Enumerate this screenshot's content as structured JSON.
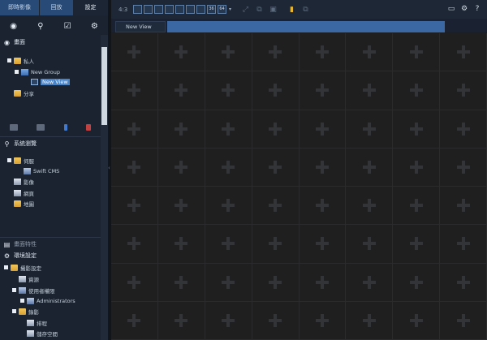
{
  "nav": {
    "tabs": [
      "即時影像",
      "回放",
      "設定"
    ]
  },
  "view_panel": {
    "title": "畫面",
    "tree": [
      {
        "label": "私人"
      },
      {
        "label": "New Group"
      },
      {
        "label": "New View",
        "selected": true
      },
      {
        "label": "分享"
      }
    ]
  },
  "system_panel": {
    "title": "系統瀏覽",
    "tree": [
      {
        "label": "伺服"
      },
      {
        "label": "Swift CMS"
      },
      {
        "label": "影像"
      },
      {
        "label": "網頁"
      },
      {
        "label": "地圖"
      }
    ]
  },
  "properties_panel": {
    "title": "畫面特性"
  },
  "env_panel": {
    "title": "環境設定",
    "tree": [
      {
        "label": "攝影設定"
      },
      {
        "label": "資源"
      },
      {
        "label": "使用者權限"
      },
      {
        "label": "Administrators"
      },
      {
        "label": "錄影"
      },
      {
        "label": "排程"
      },
      {
        "label": "儲存空間"
      }
    ]
  },
  "toolbar": {
    "aspect": "4:3",
    "layout_64": "64",
    "layout_36": "36"
  },
  "view_tab": {
    "label": "New View"
  },
  "grid": {
    "columns": 8,
    "rows": 8
  },
  "colors": {
    "accent": "#3b67a2",
    "selected": "#4b83c7"
  }
}
